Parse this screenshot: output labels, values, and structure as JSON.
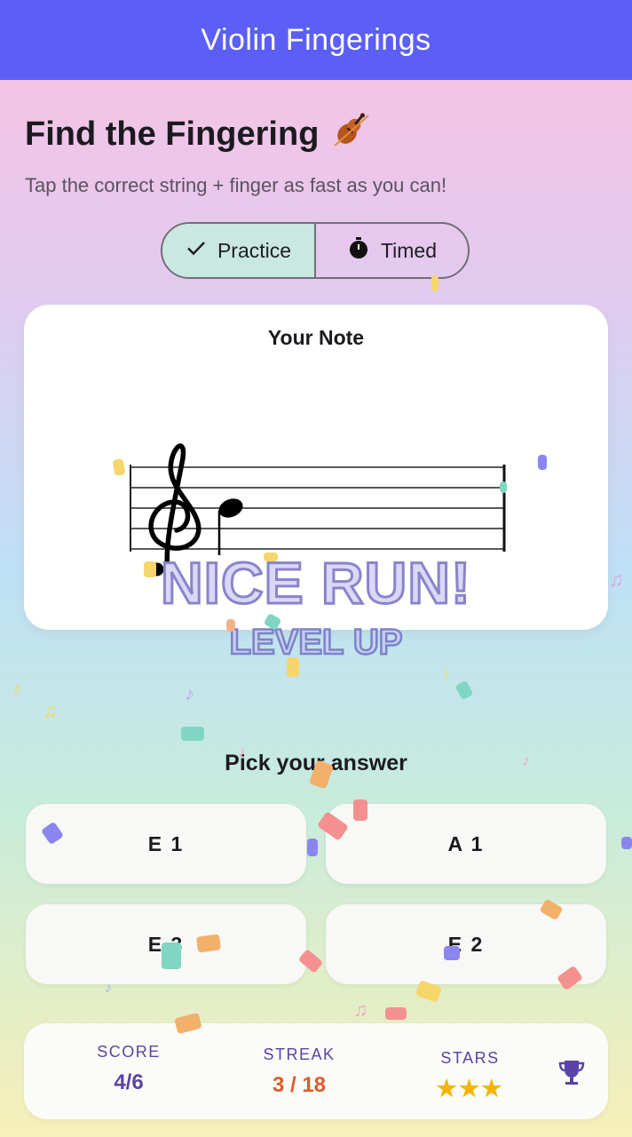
{
  "appbar": {
    "title": "Violin Fingerings"
  },
  "header": {
    "title": "Find the Fingering",
    "title_icon": "violin-icon",
    "subtitle": "Tap the correct string + finger as fast as you can!"
  },
  "mode": {
    "options": [
      {
        "label": "Practice",
        "icon": "check-icon",
        "selected": true
      },
      {
        "label": "Timed",
        "icon": "stopwatch-icon",
        "selected": false
      }
    ]
  },
  "note_card": {
    "title": "Your Note"
  },
  "celebration": {
    "headline": "NICE RUN!",
    "subline": "LEVEL UP"
  },
  "answers": {
    "prompt": "Pick your answer",
    "options": [
      "E 1",
      "A 1",
      "E 3",
      "E 2"
    ]
  },
  "stats": {
    "score": {
      "label": "SCORE",
      "value": "4/6"
    },
    "streak": {
      "label": "STREAK",
      "value": "3 / 18"
    },
    "stars": {
      "label": "STARS",
      "value": "★★★",
      "count": 3
    },
    "trophy_icon": "trophy-icon"
  },
  "colors": {
    "appbar": "#5b5ff5",
    "accent_purple": "#5a43a6",
    "streak_orange": "#e0592a",
    "star_gold": "#f5b400",
    "selected_segment": "#c9e8e0"
  }
}
